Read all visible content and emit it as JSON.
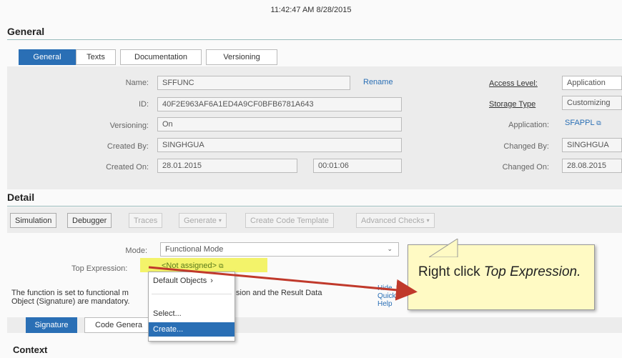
{
  "timestamp": "11:42:47 AM 8/28/2015",
  "general": {
    "title": "General",
    "tabs": [
      "General",
      "Texts",
      "Documentation",
      "Versioning"
    ],
    "fields": {
      "name_label": "Name:",
      "name_value": "SFFUNC",
      "rename_link": "Rename",
      "id_label": "ID:",
      "id_value": "40F2E963AF6A1ED4A9CF0BFB6781A643",
      "versioning_label": "Versioning:",
      "versioning_value": "On",
      "created_by_label": "Created By:",
      "created_by_value": "SINGHGUA",
      "created_on_label": "Created On:",
      "created_on_date": "28.01.2015",
      "created_on_time": "00:01:06",
      "access_level_label": "Access Level:",
      "access_level_value": "Application",
      "storage_type_label": "Storage Type",
      "storage_type_value": "Customizing",
      "application_label": "Application:",
      "application_value": "SFAPPL",
      "changed_by_label": "Changed By:",
      "changed_by_value": "SINGHGUA",
      "changed_on_label": "Changed On:",
      "changed_on_value": "28.08.2015"
    }
  },
  "detail": {
    "title": "Detail",
    "toolbar": [
      "Simulation",
      "Debugger",
      "Traces",
      "Generate",
      "Create Code Template",
      "Advanced Checks"
    ],
    "mode_label": "Mode:",
    "mode_value": "Functional Mode",
    "top_expression_label": "Top Expression:",
    "top_expression_value": "<Not assigned>",
    "info_text_1": "The function is set to functional m",
    "info_text_1b": "sion and the Result Data",
    "info_text_2": "Object (Signature) are mandatory.",
    "help_link": [
      "Hide",
      "Quick",
      "Help"
    ],
    "bottom_tabs": [
      "Signature",
      "Code Genera"
    ]
  },
  "context_menu": {
    "items": [
      "Default Objects",
      "Select...",
      "Create..."
    ],
    "selected": "Create..."
  },
  "callout": {
    "text_prefix": "Right click ",
    "text_emph": "Top Expression."
  },
  "context": {
    "title": "Context"
  },
  "colors": {
    "accent": "#2a6fb5",
    "highlight": "#f3f36a",
    "callout_bg": "#fffac4",
    "arrow": "#c0392b"
  }
}
